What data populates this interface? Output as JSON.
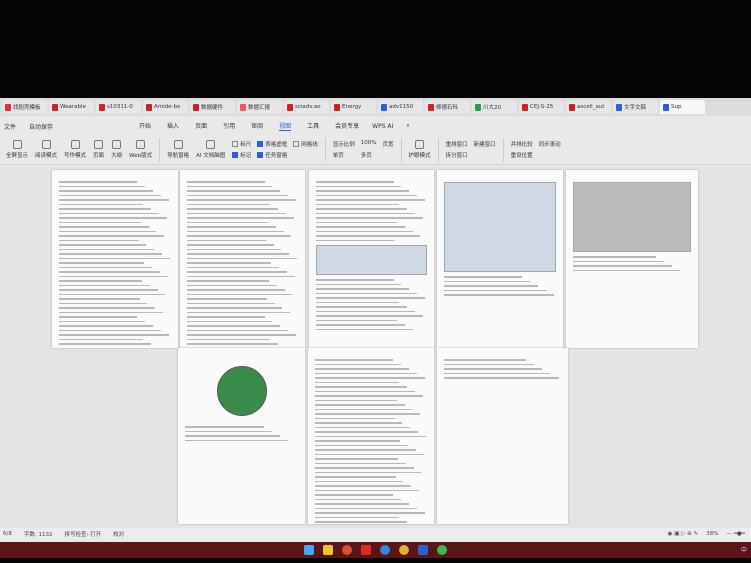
{
  "tabs": [
    {
      "label": "找稻壳模板",
      "color": "#d33"
    },
    {
      "label": "Wearable",
      "color": "#c22"
    },
    {
      "label": "s10311-0",
      "color": "#c22"
    },
    {
      "label": "Amide-bo",
      "color": "#c22"
    },
    {
      "label": "数据硬件",
      "color": "#c22"
    },
    {
      "label": "数据汇报",
      "color": "#e55"
    },
    {
      "label": "sciadv.ao",
      "color": "#c22"
    },
    {
      "label": "Energy",
      "color": "#c22"
    },
    {
      "label": "adv1150",
      "color": "#2b5fd9"
    },
    {
      "label": "柳德石科",
      "color": "#c22"
    },
    {
      "label": "川大20",
      "color": "#2a9a4a"
    },
    {
      "label": "CEJ-S-25",
      "color": "#c22"
    },
    {
      "label": "ascell_aut",
      "color": "#c22"
    },
    {
      "label": "文字文稿",
      "color": "#2b5fd9"
    },
    {
      "label": "Sup",
      "color": "#2b5fd9"
    }
  ],
  "menu": {
    "file": "文件",
    "autosave": "自动保存",
    "items": [
      "开始",
      "插入",
      "页面",
      "引用",
      "审阅",
      "视图",
      "工具",
      "会员专享"
    ],
    "active": "视图",
    "wps_ai": "WPS AI"
  },
  "toolbar": {
    "buttons": [
      "全屏显示",
      "阅读模式",
      "写作模式",
      "页面",
      "大纲",
      "Web版式",
      "导航窗格",
      "AI 文档脑图"
    ],
    "checks": [
      {
        "label": "标尺",
        "on": false
      },
      {
        "label": "表格虚框",
        "on": true
      },
      {
        "label": "网格线",
        "on": false
      },
      {
        "label": "标记",
        "on": true
      },
      {
        "label": "任务窗格",
        "on": true
      }
    ],
    "zoom_group": [
      "显示比例",
      "100%",
      "页宽",
      "单页",
      "多页"
    ],
    "protect": "护眼模式",
    "windows": [
      "重排窗口",
      "新建窗口",
      "拆分窗口"
    ],
    "compare": [
      "并排比较",
      "同步滚动",
      "重设位置"
    ]
  },
  "status": {
    "page": "6/8",
    "words": "字数: 1132",
    "spell": "拼写检查: 打开",
    "proof": "校对",
    "zoom": "38%"
  },
  "tray": {
    "ime": "中"
  }
}
